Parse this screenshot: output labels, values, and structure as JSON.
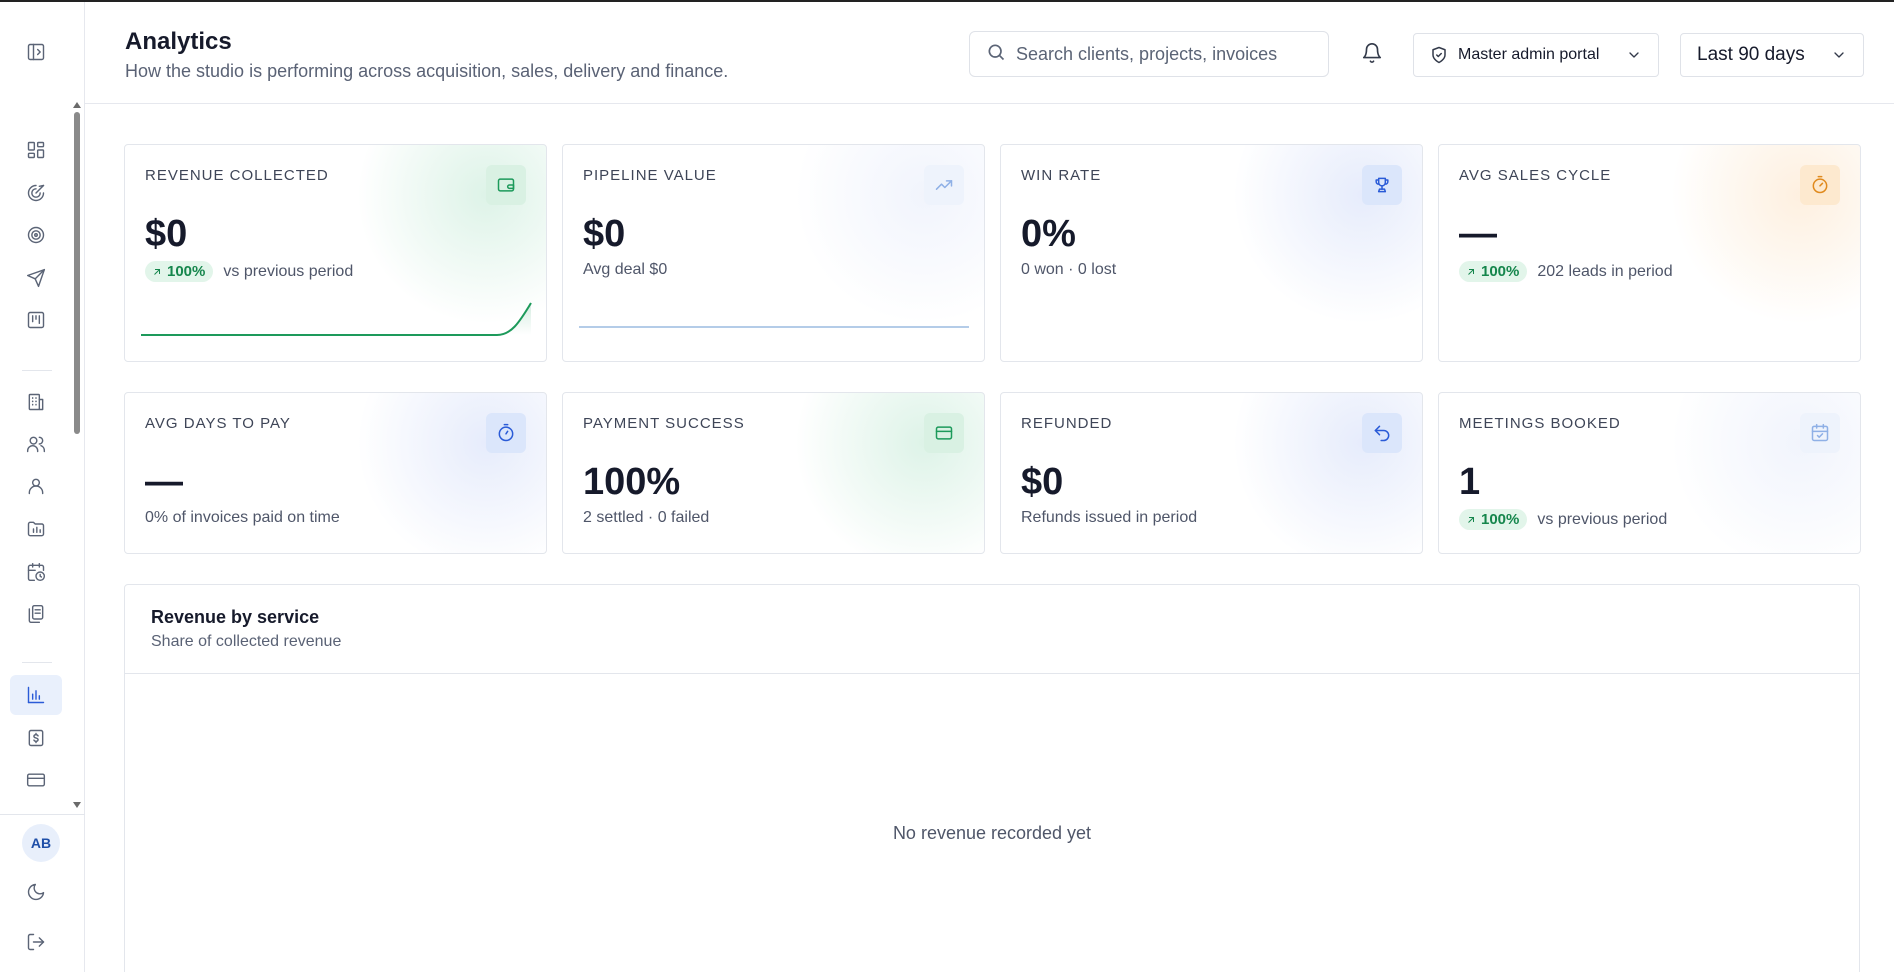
{
  "header": {
    "title": "Analytics",
    "subtitle": "How the studio is performing across acquisition, sales, delivery and finance.",
    "search_placeholder": "Search clients, projects, invoices",
    "portal_label": "Master admin portal",
    "range_label": "Last 90 days"
  },
  "sidebar": {
    "avatar_initials": "AB",
    "items": [
      {
        "icon": "dashboard-icon",
        "active": false
      },
      {
        "icon": "acquisition-icon",
        "active": false
      },
      {
        "icon": "target-icon",
        "active": false
      },
      {
        "icon": "send-icon",
        "active": false
      },
      {
        "icon": "kanban-icon",
        "active": false
      },
      {
        "icon": "building-icon",
        "active": false
      },
      {
        "icon": "users-icon",
        "active": false
      },
      {
        "icon": "user-icon",
        "active": false
      },
      {
        "icon": "folder-chart-icon",
        "active": false
      },
      {
        "icon": "calendar-clock-icon",
        "active": false
      },
      {
        "icon": "documents-icon",
        "active": false
      },
      {
        "icon": "bar-chart-icon",
        "active": true
      },
      {
        "icon": "invoice-dollar-icon",
        "active": false
      },
      {
        "icon": "credit-card-icon",
        "active": false
      }
    ]
  },
  "cards": {
    "revenue": {
      "label": "REVENUE COLLECTED",
      "value": "$0",
      "delta": "100%",
      "note": "vs previous period",
      "icon": "wallet-icon"
    },
    "pipeline": {
      "label": "PIPELINE VALUE",
      "value": "$0",
      "note": "Avg deal $0",
      "icon": "trend-up-icon"
    },
    "winrate": {
      "label": "WIN RATE",
      "value": "0%",
      "note": "0 won · 0 lost",
      "icon": "trophy-icon"
    },
    "salescycle": {
      "label": "AVG SALES CYCLE",
      "value": "—",
      "delta": "100%",
      "note": "202 leads in period",
      "icon": "timer-icon"
    },
    "daystopay": {
      "label": "AVG DAYS TO PAY",
      "value": "—",
      "note": "0% of invoices paid on time",
      "icon": "stopwatch-icon"
    },
    "payment": {
      "label": "PAYMENT SUCCESS",
      "value": "100%",
      "note": "2 settled · 0 failed",
      "icon": "card-icon"
    },
    "refunded": {
      "label": "REFUNDED",
      "value": "$0",
      "note": "Refunds issued in period",
      "icon": "undo-icon"
    },
    "meetings": {
      "label": "MEETINGS BOOKED",
      "value": "1",
      "delta": "100%",
      "note": "vs previous period",
      "icon": "calendar-check-icon"
    }
  },
  "revenue_panel": {
    "title": "Revenue by service",
    "subtitle": "Share of collected revenue",
    "empty_text": "No revenue recorded yet"
  },
  "colors": {
    "accent_green": "#1d9a5b",
    "accent_blue": "#2a5bd7",
    "accent_orange": "#e08a1e",
    "active_nav_bg": "#e9f0fc"
  }
}
